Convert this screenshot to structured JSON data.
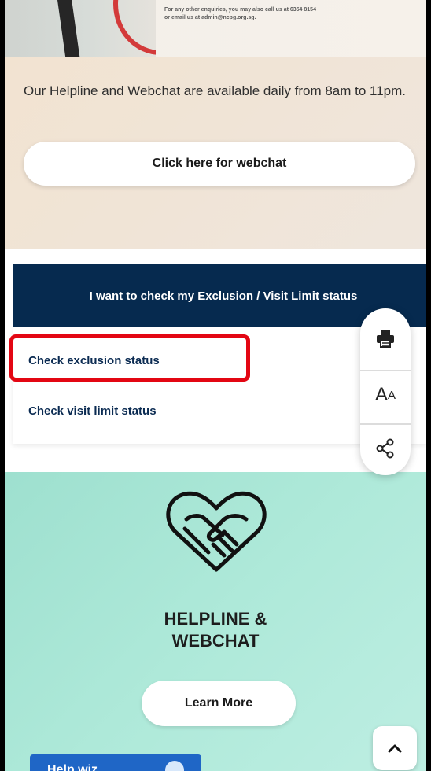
{
  "hero": {
    "note_line1": "For any other enquiries, you may also call us at 6354 8154",
    "note_line2": "or email us at admin@ncpg.org.sg."
  },
  "helpline": {
    "text": "Our Helpline and Webchat are available daily from 8am to 11pm.",
    "webchat_button": "Click here for webchat"
  },
  "status": {
    "title": "I want to check my Exclusion / Visit Limit status",
    "items": [
      {
        "label": "Check exclusion status"
      },
      {
        "label": "Check visit limit status"
      }
    ]
  },
  "toolbar": {
    "print_icon": "printer-icon",
    "text_size_big": "A",
    "text_size_small": "A",
    "share_icon": "share-icon"
  },
  "promo": {
    "icon": "heart-handshake-icon",
    "title_line1": "HELPLINE &",
    "title_line2": "WEBCHAT",
    "button": "Learn More"
  },
  "help_chip": {
    "label": "Help wiz"
  },
  "colors": {
    "navy": "#062a4f",
    "highlight": "#e30613",
    "mint": "#aee9d9",
    "beige": "#f0e4d6",
    "chip": "#1f66c6"
  }
}
